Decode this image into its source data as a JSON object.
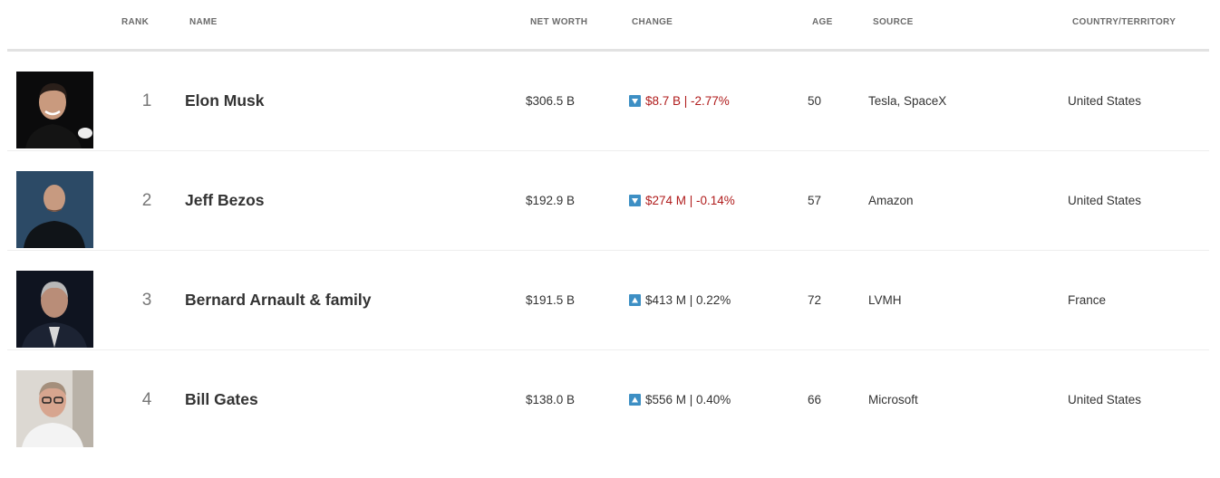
{
  "columns": {
    "rank": "RANK",
    "name": "NAME",
    "net_worth": "NET WORTH",
    "change": "CHANGE",
    "age": "AGE",
    "source": "SOURCE",
    "country": "COUNTRY/TERRITORY"
  },
  "colors": {
    "negative": "#b01c1c",
    "arrow_icon": "#3d8fc4",
    "header_text": "#6b6b6b"
  },
  "rows": [
    {
      "rank": "1",
      "name": "Elon Musk",
      "net_worth": "$306.5 B",
      "change": "$8.7 B | -2.77%",
      "direction": "down",
      "age": "50",
      "source": "Tesla, SpaceX",
      "country": "United States"
    },
    {
      "rank": "2",
      "name": "Jeff Bezos",
      "net_worth": "$192.9 B",
      "change": "$274 M | -0.14%",
      "direction": "down",
      "age": "57",
      "source": "Amazon",
      "country": "United States"
    },
    {
      "rank": "3",
      "name": "Bernard Arnault & family",
      "net_worth": "$191.5 B",
      "change": "$413 M | 0.22%",
      "direction": "up",
      "age": "72",
      "source": "LVMH",
      "country": "France"
    },
    {
      "rank": "4",
      "name": "Bill Gates",
      "net_worth": "$138.0 B",
      "change": "$556 M | 0.40%",
      "direction": "up",
      "age": "66",
      "source": "Microsoft",
      "country": "United States"
    }
  ]
}
